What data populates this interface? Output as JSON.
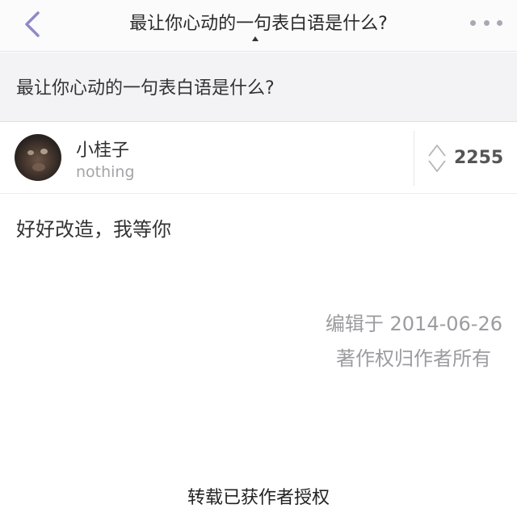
{
  "navbar": {
    "back_icon": "chevron-left-icon",
    "title": "最让你心动的一句表白语是什么?",
    "more_icon": "more-horizontal-icon"
  },
  "question": {
    "title": "最让你心动的一句表白语是什么?"
  },
  "author": {
    "name": "小桂子",
    "bio": "nothing",
    "avatar_icon": "avatar-photo"
  },
  "vote": {
    "icon": "vote-arrows-icon",
    "count": "2255"
  },
  "answer": {
    "text": "好好改造，我等你",
    "edit_date": "编辑于 2014-06-26",
    "copyright": "著作权归作者所有"
  },
  "footer": {
    "repost_note": "转载已获作者授权"
  },
  "colors": {
    "accent_back": "#8d8bc7",
    "more_dots": "#a9a9b2",
    "question_bg": "#f3f3f6",
    "muted_text": "#9c9ca0"
  }
}
